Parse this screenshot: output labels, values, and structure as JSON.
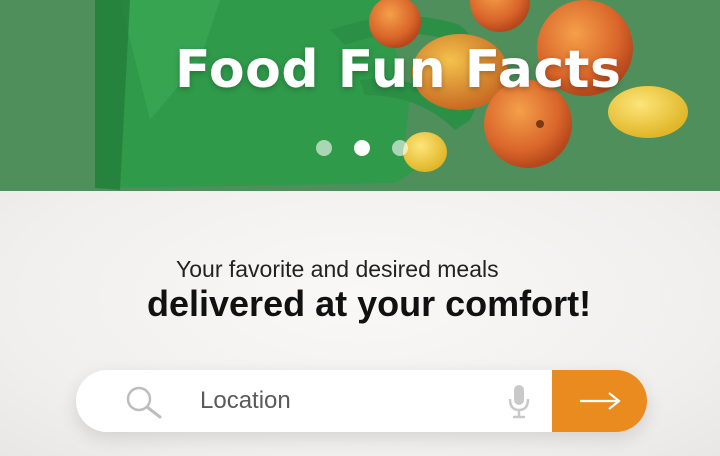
{
  "hero": {
    "title": "Food Fun Facts",
    "slide_count": 3,
    "active_slide": 2
  },
  "main": {
    "tagline": "Your favorite and desired meals",
    "headline": "delivered at your comfort!"
  },
  "search": {
    "value": "",
    "placeholder": "Location",
    "leading_icon": "search-icon",
    "voice_icon": "microphone-icon",
    "submit_icon": "arrow-right-icon"
  },
  "colors": {
    "hero_background": "#4f8f5b",
    "accent": "#e98b1e",
    "page_background": "#f3f1f0",
    "text_dark": "#111111"
  }
}
